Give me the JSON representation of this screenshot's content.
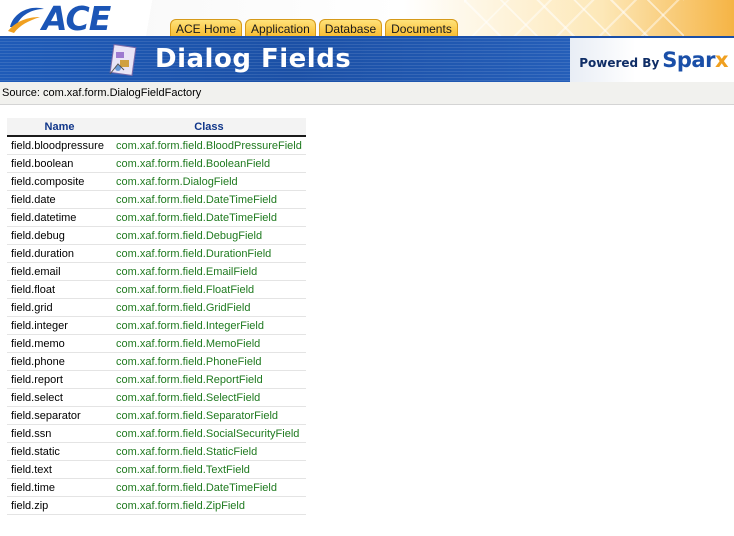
{
  "header": {
    "logo_text": "ACE",
    "nav_tabs": [
      "ACE Home",
      "Application",
      "Database",
      "Documents"
    ]
  },
  "banner": {
    "title": "Dialog Fields",
    "powered_by": "Powered By",
    "brand": "Spar",
    "brand_x": "x"
  },
  "source": {
    "text": "Source: com.xaf.form.DialogFieldFactory"
  },
  "table": {
    "headers": [
      "Name",
      "Class"
    ],
    "rows": [
      {
        "name": "field.bloodpressure",
        "class": "com.xaf.form.field.BloodPressureField"
      },
      {
        "name": "field.boolean",
        "class": "com.xaf.form.field.BooleanField"
      },
      {
        "name": "field.composite",
        "class": "com.xaf.form.DialogField"
      },
      {
        "name": "field.date",
        "class": "com.xaf.form.field.DateTimeField"
      },
      {
        "name": "field.datetime",
        "class": "com.xaf.form.field.DateTimeField"
      },
      {
        "name": "field.debug",
        "class": "com.xaf.form.field.DebugField"
      },
      {
        "name": "field.duration",
        "class": "com.xaf.form.field.DurationField"
      },
      {
        "name": "field.email",
        "class": "com.xaf.form.field.EmailField"
      },
      {
        "name": "field.float",
        "class": "com.xaf.form.field.FloatField"
      },
      {
        "name": "field.grid",
        "class": "com.xaf.form.field.GridField"
      },
      {
        "name": "field.integer",
        "class": "com.xaf.form.field.IntegerField"
      },
      {
        "name": "field.memo",
        "class": "com.xaf.form.field.MemoField"
      },
      {
        "name": "field.phone",
        "class": "com.xaf.form.field.PhoneField"
      },
      {
        "name": "field.report",
        "class": "com.xaf.form.field.ReportField"
      },
      {
        "name": "field.select",
        "class": "com.xaf.form.field.SelectField"
      },
      {
        "name": "field.separator",
        "class": "com.xaf.form.field.SeparatorField"
      },
      {
        "name": "field.ssn",
        "class": "com.xaf.form.field.SocialSecurityField"
      },
      {
        "name": "field.static",
        "class": "com.xaf.form.field.StaticField"
      },
      {
        "name": "field.text",
        "class": "com.xaf.form.field.TextField"
      },
      {
        "name": "field.time",
        "class": "com.xaf.form.field.DateTimeField"
      },
      {
        "name": "field.zip",
        "class": "com.xaf.form.field.ZipField"
      }
    ]
  },
  "colors": {
    "brand_blue": "#1b55b6",
    "banner_blue": "#1f5bb8",
    "tab_gold": "#f8b92a",
    "class_green": "#1f7a1f",
    "header_text": "#10368a"
  },
  "icons": [
    "ace-swoosh-logo-icon",
    "dialog-fields-icon"
  ]
}
